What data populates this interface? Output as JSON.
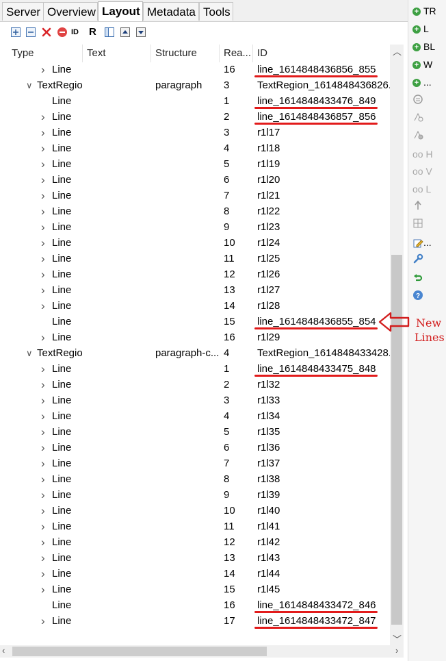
{
  "tabs": [
    {
      "label": "Server"
    },
    {
      "label": "Overview"
    },
    {
      "label": "Layout"
    },
    {
      "label": "Metadata"
    },
    {
      "label": "Tools"
    }
  ],
  "toolbar": {
    "icons": [
      "expand-all-icon",
      "collapse-all-icon",
      "delete-icon",
      "remove-icon",
      "id-icon",
      "reading-order-icon",
      "table-icon",
      "move-up-icon",
      "move-down-icon"
    ],
    "id_label": "ID",
    "r_label": "R"
  },
  "columns": [
    "Type",
    "Text",
    "Structure",
    "Rea...",
    "ID"
  ],
  "rows": [
    {
      "indent": 1,
      "expand": true,
      "type": "Line",
      "text": "",
      "structure": "",
      "order": "16",
      "id": "line_1614848436856_855",
      "marked": true
    },
    {
      "indent": 0,
      "expand": "open",
      "type": "TextRegio",
      "text": "",
      "structure": "paragraph",
      "order": "3",
      "id": "TextRegion_1614848436826...",
      "marked": false
    },
    {
      "indent": 1,
      "expand": false,
      "type": "Line",
      "text": "",
      "structure": "",
      "order": "1",
      "id": "line_1614848433476_849",
      "marked": true
    },
    {
      "indent": 1,
      "expand": true,
      "type": "Line",
      "text": "",
      "structure": "",
      "order": "2",
      "id": "line_1614848436857_856",
      "marked": true
    },
    {
      "indent": 1,
      "expand": true,
      "type": "Line",
      "text": "",
      "structure": "",
      "order": "3",
      "id": "r1l17",
      "marked": false
    },
    {
      "indent": 1,
      "expand": true,
      "type": "Line",
      "text": "",
      "structure": "",
      "order": "4",
      "id": "r1l18",
      "marked": false
    },
    {
      "indent": 1,
      "expand": true,
      "type": "Line",
      "text": "",
      "structure": "",
      "order": "5",
      "id": "r1l19",
      "marked": false
    },
    {
      "indent": 1,
      "expand": true,
      "type": "Line",
      "text": "",
      "structure": "",
      "order": "6",
      "id": "r1l20",
      "marked": false
    },
    {
      "indent": 1,
      "expand": true,
      "type": "Line",
      "text": "",
      "structure": "",
      "order": "7",
      "id": "r1l21",
      "marked": false
    },
    {
      "indent": 1,
      "expand": true,
      "type": "Line",
      "text": "",
      "structure": "",
      "order": "8",
      "id": "r1l22",
      "marked": false
    },
    {
      "indent": 1,
      "expand": true,
      "type": "Line",
      "text": "",
      "structure": "",
      "order": "9",
      "id": "r1l23",
      "marked": false
    },
    {
      "indent": 1,
      "expand": true,
      "type": "Line",
      "text": "",
      "structure": "",
      "order": "10",
      "id": "r1l24",
      "marked": false
    },
    {
      "indent": 1,
      "expand": true,
      "type": "Line",
      "text": "",
      "structure": "",
      "order": "11",
      "id": "r1l25",
      "marked": false
    },
    {
      "indent": 1,
      "expand": true,
      "type": "Line",
      "text": "",
      "structure": "",
      "order": "12",
      "id": "r1l26",
      "marked": false
    },
    {
      "indent": 1,
      "expand": true,
      "type": "Line",
      "text": "",
      "structure": "",
      "order": "13",
      "id": "r1l27",
      "marked": false
    },
    {
      "indent": 1,
      "expand": true,
      "type": "Line",
      "text": "",
      "structure": "",
      "order": "14",
      "id": "r1l28",
      "marked": false
    },
    {
      "indent": 1,
      "expand": false,
      "type": "Line",
      "text": "",
      "structure": "",
      "order": "15",
      "id": "line_1614848436855_854",
      "marked": true
    },
    {
      "indent": 1,
      "expand": true,
      "type": "Line",
      "text": "",
      "structure": "",
      "order": "16",
      "id": "r1l29",
      "marked": false
    },
    {
      "indent": 0,
      "expand": "open",
      "type": "TextRegio",
      "text": "",
      "structure": "paragraph-c...",
      "order": "4",
      "id": "TextRegion_1614848433428...",
      "marked": false
    },
    {
      "indent": 1,
      "expand": true,
      "type": "Line",
      "text": "",
      "structure": "",
      "order": "1",
      "id": "line_1614848433475_848",
      "marked": true
    },
    {
      "indent": 1,
      "expand": true,
      "type": "Line",
      "text": "",
      "structure": "",
      "order": "2",
      "id": "r1l32",
      "marked": false
    },
    {
      "indent": 1,
      "expand": true,
      "type": "Line",
      "text": "",
      "structure": "",
      "order": "3",
      "id": "r1l33",
      "marked": false
    },
    {
      "indent": 1,
      "expand": true,
      "type": "Line",
      "text": "",
      "structure": "",
      "order": "4",
      "id": "r1l34",
      "marked": false
    },
    {
      "indent": 1,
      "expand": true,
      "type": "Line",
      "text": "",
      "structure": "",
      "order": "5",
      "id": "r1l35",
      "marked": false
    },
    {
      "indent": 1,
      "expand": true,
      "type": "Line",
      "text": "",
      "structure": "",
      "order": "6",
      "id": "r1l36",
      "marked": false
    },
    {
      "indent": 1,
      "expand": true,
      "type": "Line",
      "text": "",
      "structure": "",
      "order": "7",
      "id": "r1l37",
      "marked": false
    },
    {
      "indent": 1,
      "expand": true,
      "type": "Line",
      "text": "",
      "structure": "",
      "order": "8",
      "id": "r1l38",
      "marked": false
    },
    {
      "indent": 1,
      "expand": true,
      "type": "Line",
      "text": "",
      "structure": "",
      "order": "9",
      "id": "r1l39",
      "marked": false
    },
    {
      "indent": 1,
      "expand": true,
      "type": "Line",
      "text": "",
      "structure": "",
      "order": "10",
      "id": "r1l40",
      "marked": false
    },
    {
      "indent": 1,
      "expand": true,
      "type": "Line",
      "text": "",
      "structure": "",
      "order": "11",
      "id": "r1l41",
      "marked": false
    },
    {
      "indent": 1,
      "expand": true,
      "type": "Line",
      "text": "",
      "structure": "",
      "order": "12",
      "id": "r1l42",
      "marked": false
    },
    {
      "indent": 1,
      "expand": true,
      "type": "Line",
      "text": "",
      "structure": "",
      "order": "13",
      "id": "r1l43",
      "marked": false
    },
    {
      "indent": 1,
      "expand": true,
      "type": "Line",
      "text": "",
      "structure": "",
      "order": "14",
      "id": "r1l44",
      "marked": false
    },
    {
      "indent": 1,
      "expand": true,
      "type": "Line",
      "text": "",
      "structure": "",
      "order": "15",
      "id": "r1l45",
      "marked": false
    },
    {
      "indent": 1,
      "expand": false,
      "type": "Line",
      "text": "",
      "structure": "",
      "order": "16",
      "id": "line_1614848433472_846",
      "marked": true
    },
    {
      "indent": 1,
      "expand": true,
      "type": "Line",
      "text": "",
      "structure": "",
      "order": "17",
      "id": "line_1614848433472_847",
      "marked": true
    }
  ],
  "side_buttons": [
    {
      "label": "TR"
    },
    {
      "label": "L"
    },
    {
      "label": "BL"
    },
    {
      "label": "W"
    },
    {
      "label": "..."
    }
  ],
  "side_icons": [
    "merge-icon",
    "add-point-icon",
    "remove-point-icon",
    "glasses-h-icon",
    "glasses-v-icon",
    "glasses-l-icon",
    "split-icon",
    "grid-icon",
    "edit-icon",
    "wrench-icon",
    "undo-icon",
    "help-icon"
  ],
  "side_icon_labels": {
    "h": "H",
    "v": "V",
    "l": "L",
    "edit": "..."
  },
  "annotation": {
    "text_line1": "New",
    "text_line2": "Lines",
    "color": "#d21d1d"
  },
  "colors": {
    "accent_red": "#e21b1b",
    "add_green": "#3ea043"
  }
}
